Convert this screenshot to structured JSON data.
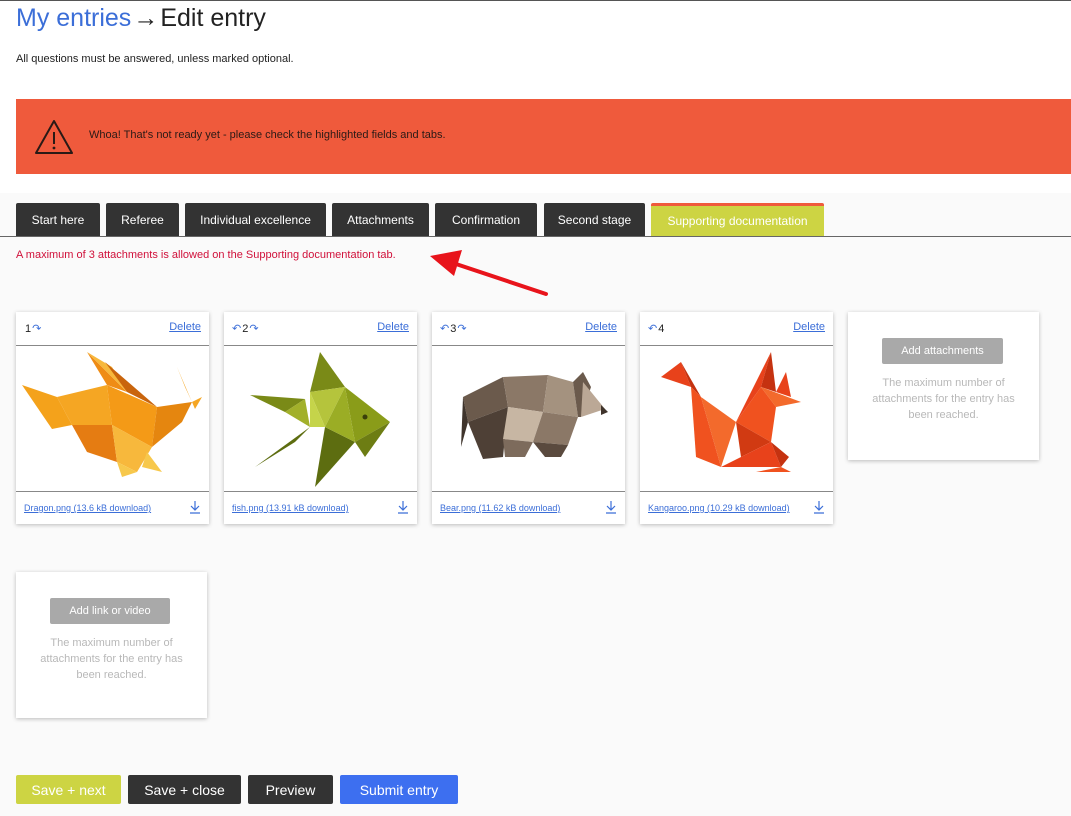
{
  "header": {
    "breadcrumb_link": "My entries",
    "breadcrumb_arrow": "→",
    "breadcrumb_current": "Edit entry",
    "subtitle": "All questions must be answered, unless marked optional."
  },
  "alert": {
    "message": "Whoa! That's not ready yet - please check the highlighted fields and tabs.",
    "color": "#ef5a3c"
  },
  "tabs": [
    {
      "label": "Start here"
    },
    {
      "label": "Referee"
    },
    {
      "label": "Individual excellence"
    },
    {
      "label": "Attachments"
    },
    {
      "label": "Confirmation"
    },
    {
      "label": "Second stage"
    },
    {
      "label": "Supporting documentation",
      "active": true
    }
  ],
  "error_message": "A maximum of 3 attachments is allowed on the Supporting documentation tab.",
  "attachments": [
    {
      "number": "1",
      "left_arrow": "",
      "right_arrow": "↷",
      "delete_label": "Delete",
      "file_label": "Dragon.png (13.6 kB download)",
      "image": "orange origami dragon"
    },
    {
      "number": "2",
      "left_arrow": "↶",
      "right_arrow": "↷",
      "delete_label": "Delete",
      "file_label": "fish.png (13.91 kB download)",
      "image": "green origami fish"
    },
    {
      "number": "3",
      "left_arrow": "↶",
      "right_arrow": "↷",
      "delete_label": "Delete",
      "file_label": "Bear.png (11.62 kB download)",
      "image": "brown origami bear"
    },
    {
      "number": "4",
      "left_arrow": "↶",
      "right_arrow": "",
      "delete_label": "Delete",
      "file_label": "Kangaroo.png (10.29 kB download)",
      "image": "red origami kangaroo"
    }
  ],
  "add_attachments": {
    "button_label": "Add attachments",
    "note": "The maximum number of attachments for the entry has been reached."
  },
  "add_link": {
    "button_label": "Add link or video",
    "note": "The maximum number of attachments for the entry has been reached."
  },
  "footer_buttons": {
    "save_next": "Save + next",
    "save_close": "Save + close",
    "preview": "Preview",
    "submit": "Submit entry"
  },
  "colors": {
    "accent_blue": "#3b6ed8",
    "tab_active": "#cdd443",
    "tab_dark": "#333333",
    "error_red": "#d0103a",
    "submit_blue": "#3d6ff0"
  }
}
